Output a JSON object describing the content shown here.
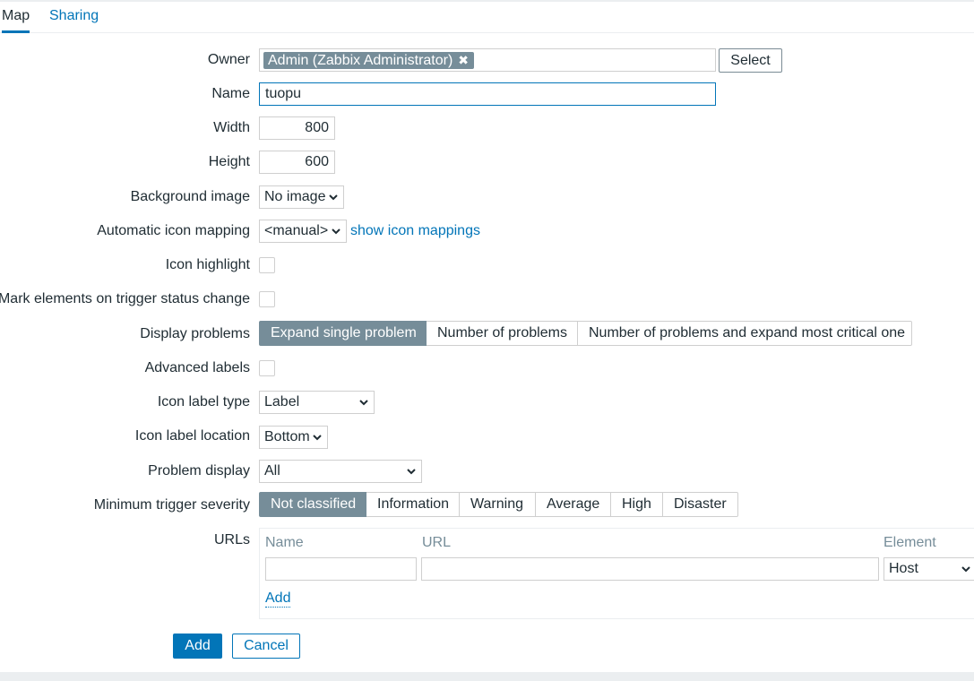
{
  "tabs": [
    {
      "label": "Map",
      "active": true
    },
    {
      "label": "Sharing",
      "active": false
    }
  ],
  "form": {
    "owner": {
      "label": "Owner",
      "chip": "Admin (Zabbix Administrator)",
      "select_button": "Select"
    },
    "name": {
      "label": "Name",
      "value": "tuopu"
    },
    "width": {
      "label": "Width",
      "value": "800"
    },
    "height": {
      "label": "Height",
      "value": "600"
    },
    "background_image": {
      "label": "Background image",
      "value": "No image"
    },
    "icon_mapping": {
      "label": "Automatic icon mapping",
      "value": "<manual>",
      "link": "show icon mappings"
    },
    "icon_highlight": {
      "label": "Icon highlight",
      "checked": false
    },
    "mark_elements": {
      "label": "Mark elements on trigger status change",
      "checked": false
    },
    "display_problems": {
      "label": "Display problems",
      "options": [
        "Expand single problem",
        "Number of problems",
        "Number of problems and expand most critical one"
      ],
      "selected": 0
    },
    "advanced_labels": {
      "label": "Advanced labels",
      "checked": false
    },
    "icon_label_type": {
      "label": "Icon label type",
      "value": "Label"
    },
    "icon_label_location": {
      "label": "Icon label location",
      "value": "Bottom"
    },
    "problem_display": {
      "label": "Problem display",
      "value": "All"
    },
    "min_severity": {
      "label": "Minimum trigger severity",
      "options": [
        "Not classified",
        "Information",
        "Warning",
        "Average",
        "High",
        "Disaster"
      ],
      "selected": 0
    },
    "urls": {
      "label": "URLs",
      "columns": [
        "Name",
        "URL",
        "Element"
      ],
      "row": {
        "name": "",
        "url": "",
        "element": "Host"
      },
      "add_link": "Add"
    }
  },
  "actions": {
    "add": "Add",
    "cancel": "Cancel"
  },
  "colors": {
    "accent": "#0275b8",
    "selected_segment": "#768d99",
    "border": "#cfcfcf"
  }
}
